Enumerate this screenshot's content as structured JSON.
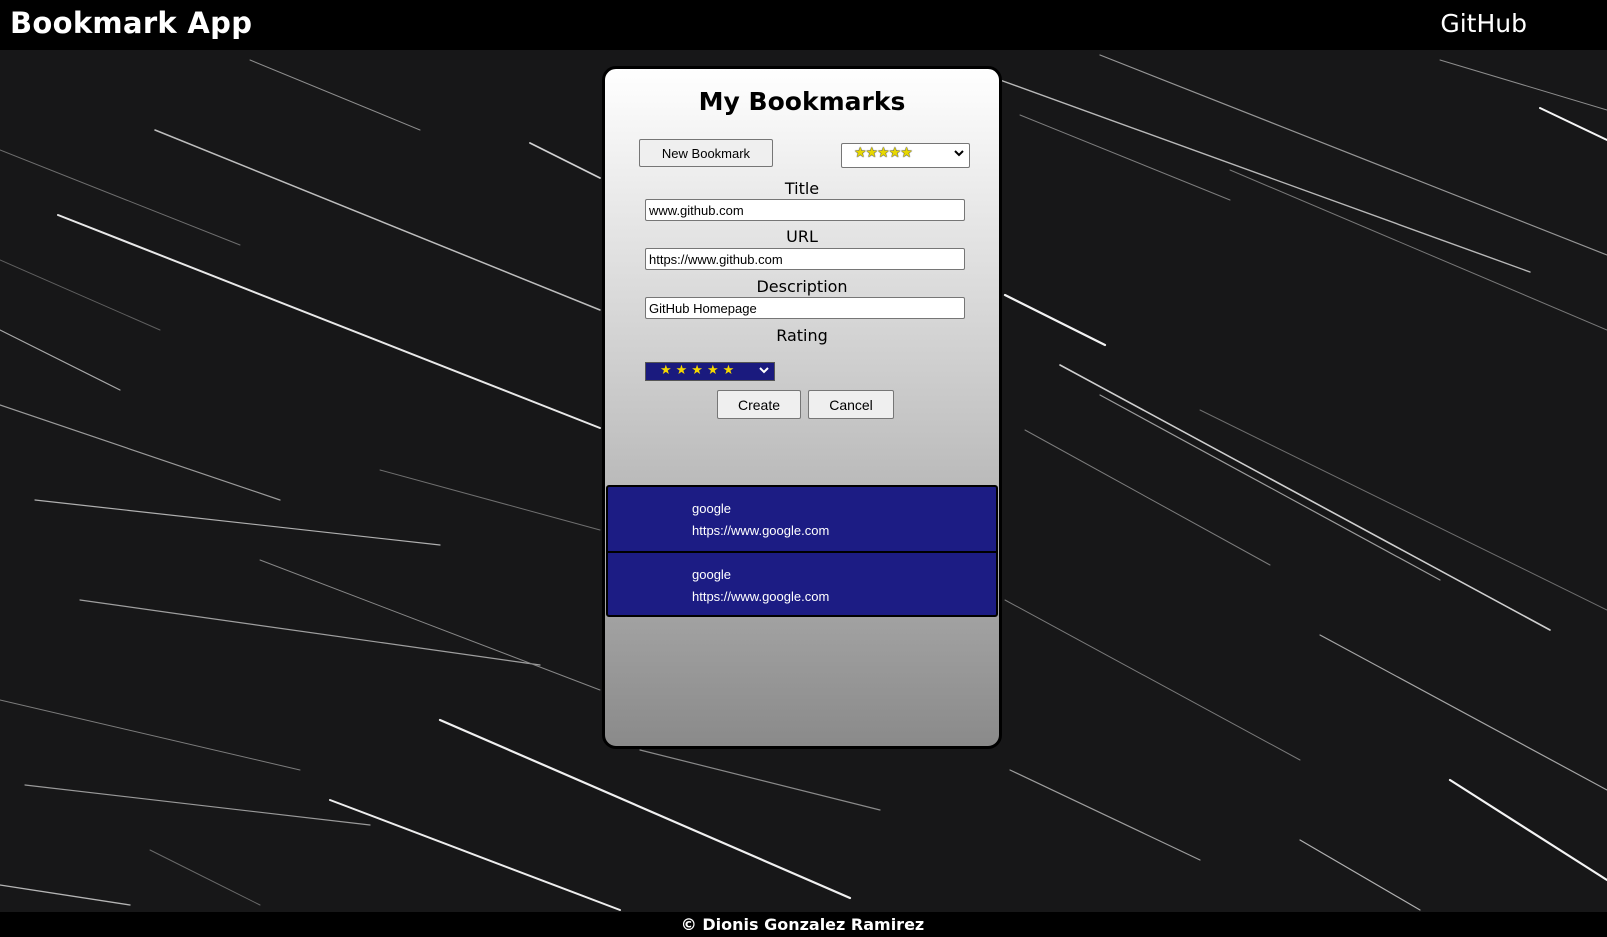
{
  "header": {
    "app_title": "Bookmark App",
    "github_link": "GitHub"
  },
  "card": {
    "title": "My Bookmarks",
    "new_bookmark_label": "New Bookmark",
    "filter_value": "★★★★★",
    "form": {
      "title_label": "Title",
      "title_value": "www.github.com",
      "url_label": "URL",
      "url_value": "https://www.github.com",
      "description_label": "Description",
      "description_value": "GitHub Homepage",
      "rating_label": "Rating",
      "rating_value": "★★★★★",
      "create_label": "Create",
      "cancel_label": "Cancel"
    },
    "bookmarks": [
      {
        "title": "google",
        "url": "https://www.google.com"
      },
      {
        "title": "google",
        "url": "https://www.google.com"
      }
    ]
  },
  "footer": {
    "text": "© Dionis Gonzalez Ramirez"
  },
  "colors": {
    "bookmark_bg": "#1c1c84",
    "header_bg": "#000000",
    "star_color": "#f5d800"
  },
  "icons": {
    "select_arrow": "chevron-down-icon"
  }
}
